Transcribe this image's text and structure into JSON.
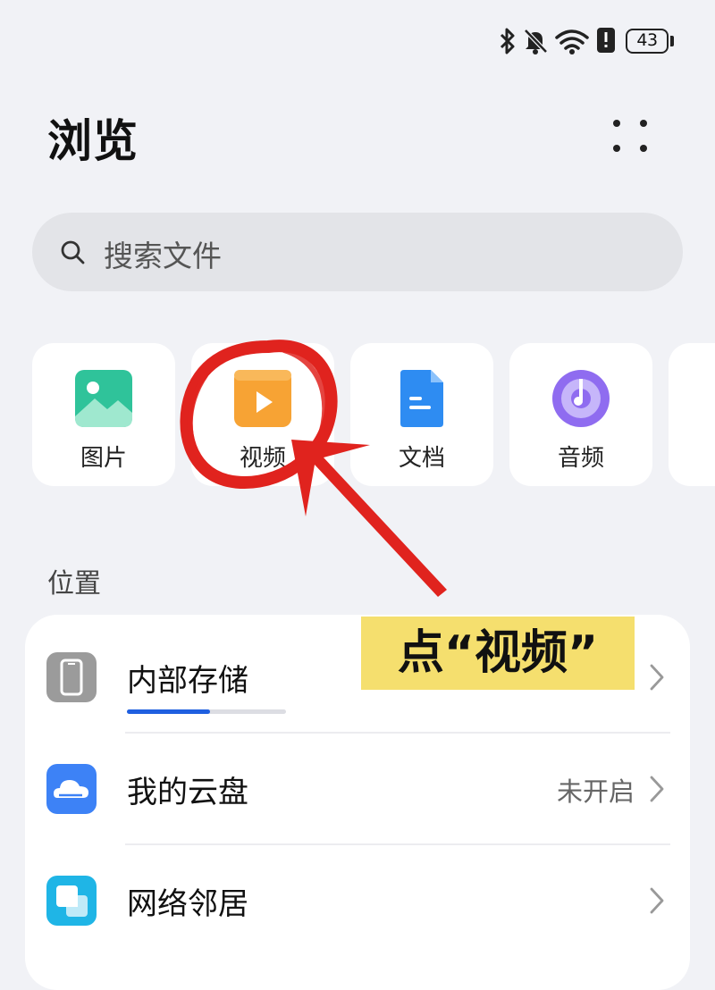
{
  "status_bar": {
    "icons": [
      "bluetooth-icon",
      "mute-bell-icon",
      "wifi-icon",
      "alert-icon"
    ],
    "battery": "43"
  },
  "header": {
    "title": "浏览",
    "more_icon": "more-dots-icon"
  },
  "search": {
    "placeholder": "搜索文件",
    "icon": "search-icon"
  },
  "categories": [
    {
      "label": "图片",
      "icon": "image-icon",
      "color": "#2fc39a"
    },
    {
      "label": "视频",
      "icon": "video-icon",
      "color": "#f7a334"
    },
    {
      "label": "文档",
      "icon": "document-icon",
      "color": "#2e8cf2"
    },
    {
      "label": "音频",
      "icon": "audio-icon",
      "color": "#8f6cf0"
    }
  ],
  "locations": {
    "title": "位置",
    "items": [
      {
        "label": "内部存储",
        "value": "",
        "icon": "phone-storage-icon",
        "usage_fraction": 0.52
      },
      {
        "label": "我的云盘",
        "value": "未开启",
        "icon": "cloud-drive-icon"
      },
      {
        "label": "网络邻居",
        "value": "",
        "icon": "network-neighbor-icon"
      }
    ]
  },
  "annotation": {
    "callout_text": "点“视频”",
    "color": "#e0231e"
  }
}
